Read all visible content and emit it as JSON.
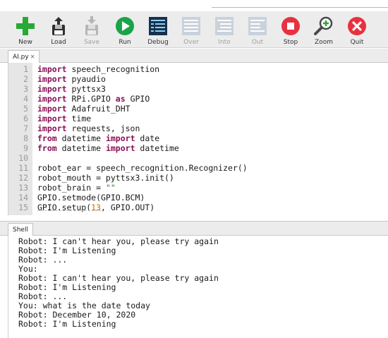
{
  "toolbar": {
    "buttons": [
      {
        "label": "New",
        "icon": "plus-icon",
        "enabled": true
      },
      {
        "label": "Load",
        "icon": "load-icon",
        "enabled": true
      },
      {
        "label": "Save",
        "icon": "save-icon",
        "enabled": false
      },
      {
        "label": "Run",
        "icon": "play-icon",
        "enabled": true
      },
      {
        "label": "Debug",
        "icon": "debug-icon",
        "enabled": true
      },
      {
        "label": "Over",
        "icon": "step-over-icon",
        "enabled": false
      },
      {
        "label": "Into",
        "icon": "step-into-icon",
        "enabled": false
      },
      {
        "label": "Out",
        "icon": "step-out-icon",
        "enabled": false
      },
      {
        "label": "Stop",
        "icon": "stop-icon",
        "enabled": true
      },
      {
        "label": "Zoom",
        "icon": "zoom-icon",
        "enabled": true
      },
      {
        "label": "Quit",
        "icon": "quit-icon",
        "enabled": true
      }
    ]
  },
  "editor": {
    "tab_label": "AI.py",
    "tab_close": "✕",
    "line_numbers": [
      "1",
      "2",
      "3",
      "4",
      "5",
      "6",
      "7",
      "8",
      "9",
      "10",
      "11",
      "12",
      "13",
      "14",
      "15"
    ],
    "code_lines": [
      "import speech_recognition",
      "import pyaudio",
      "import pyttsx3",
      "import RPi.GPIO as GPIO",
      "import Adafruit_DHT",
      "import time",
      "import requests, json",
      "from datetime import date",
      "from datetime import datetime",
      "",
      "robot_ear = speech_recognition.Recognizer()",
      "robot_mouth = pyttsx3.init()",
      "robot_brain = \"\"",
      "GPIO.setmode(GPIO.BCM)",
      "GPIO.setup(13, GPIO.OUT)"
    ]
  },
  "shell": {
    "tab_label": "Shell",
    "lines": [
      "Robot: I can't hear you, please try again",
      "Robot: I'm Listening",
      "Robot: ...",
      "You:",
      "Robot: I can't hear you, please try again",
      "Robot: I'm Listening",
      "Robot: ...",
      "You: what is the date today",
      "Robot: December 10, 2020",
      "Robot: I'm Listening"
    ]
  },
  "colors": {
    "keyword": "#8a0f57",
    "number": "#c96e00",
    "string": "#2a8a2a",
    "run_green": "#1aa34a",
    "stop_red": "#e8313f",
    "new_green": "#27a935"
  }
}
